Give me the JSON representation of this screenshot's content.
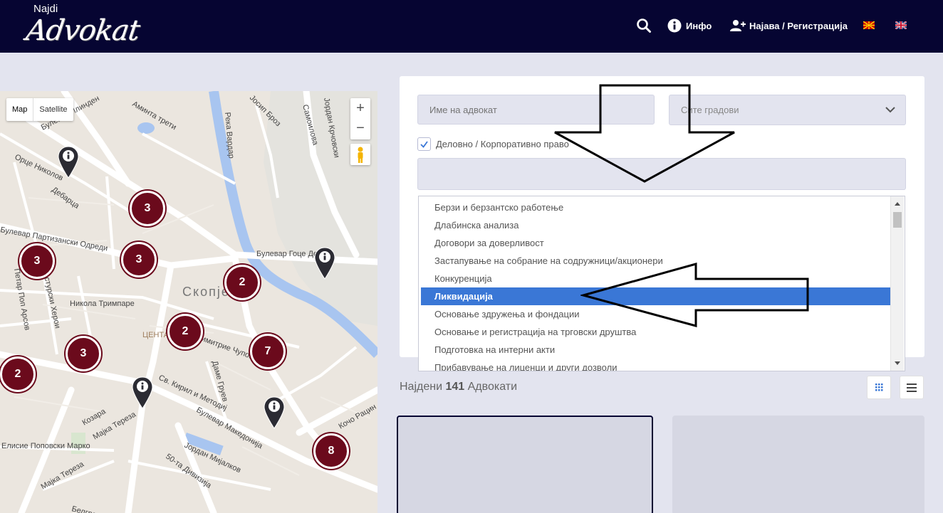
{
  "header": {
    "logo_top": "Najdi",
    "logo_main": "Advokat",
    "info_label": "Инфо",
    "login_label": "Најава / Регистрација",
    "lang_mk": "Macedonian flag",
    "lang_en": "English flag"
  },
  "map": {
    "type_map": "Map",
    "type_satellite": "Satellite",
    "zoom_in": "+",
    "zoom_out": "−",
    "clusters": [
      "3",
      "3",
      "3",
      "2",
      "2",
      "3",
      "7",
      "2",
      "8"
    ],
    "streets": [
      "Булевар Илинден",
      "Орце Николов",
      "Дебарца",
      "Аминта трети",
      "Река Вардар",
      "Јосип Броз",
      "Самоилова",
      "Јордан Хаџи Константинов",
      "Кочо Рацин",
      "Партизански Одреди",
      "Булевар Гоце Делчев",
      "Петар Поп Арсов",
      "Кострурски Херои",
      "Никола Тримпаре",
      "Скопје",
      "Центар",
      "Димитрие Чуповски",
      "Даме Груев",
      "Св. Кирил и Методиј",
      "Булевар Македонија",
      "Мајка Тереза",
      "Козара",
      "Елисие Поповски Марко",
      "Јордан Мијалков",
      "50-та Дивизија",
      "Белградска"
    ]
  },
  "filters": {
    "name_placeholder": "Име на адвокат",
    "city_value": "Сите градови",
    "category_label": "Деловно / Корпоративно право",
    "category_checked": true,
    "options": [
      "Берзи и берзантско работење",
      "Длабинска анализа",
      "Договори за доверливост",
      "Застапување на собрание на содружници/акционери",
      "Конкуренција",
      "Ликвидација",
      "Основање здружења и фондации",
      "Основање и регистрација на трговски друштва",
      "Подготовка на интерни акти",
      "Прибавување на лиценци и други дозволи"
    ],
    "selected_index": 5
  },
  "results": {
    "prefix": "Најдени",
    "count": "141",
    "suffix": "Адвокати"
  },
  "colors": {
    "header_bg": "#060532",
    "cluster": "#6b0a1c",
    "selected": "#3a77d6"
  }
}
